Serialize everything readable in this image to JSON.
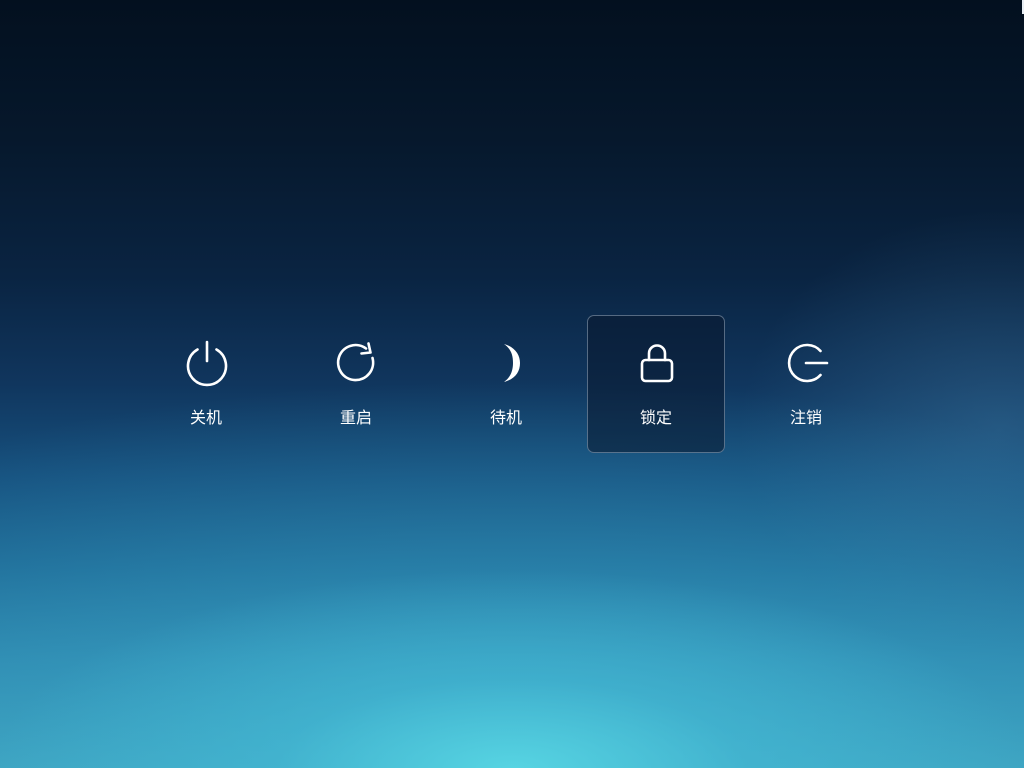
{
  "power_menu": {
    "options": [
      {
        "label": "关机",
        "icon": "power-icon"
      },
      {
        "label": "重启",
        "icon": "restart-icon"
      },
      {
        "label": "待机",
        "icon": "moon-icon"
      },
      {
        "label": "锁定",
        "icon": "lock-icon",
        "selected": true
      },
      {
        "label": "注销",
        "icon": "logout-icon"
      }
    ]
  },
  "colors": {
    "icon": "#ffffff",
    "label": "#ffffff",
    "selected_border": "#8ea4bc",
    "background_top": "#03101f",
    "background_bottom_glow": "#58d7e4"
  }
}
